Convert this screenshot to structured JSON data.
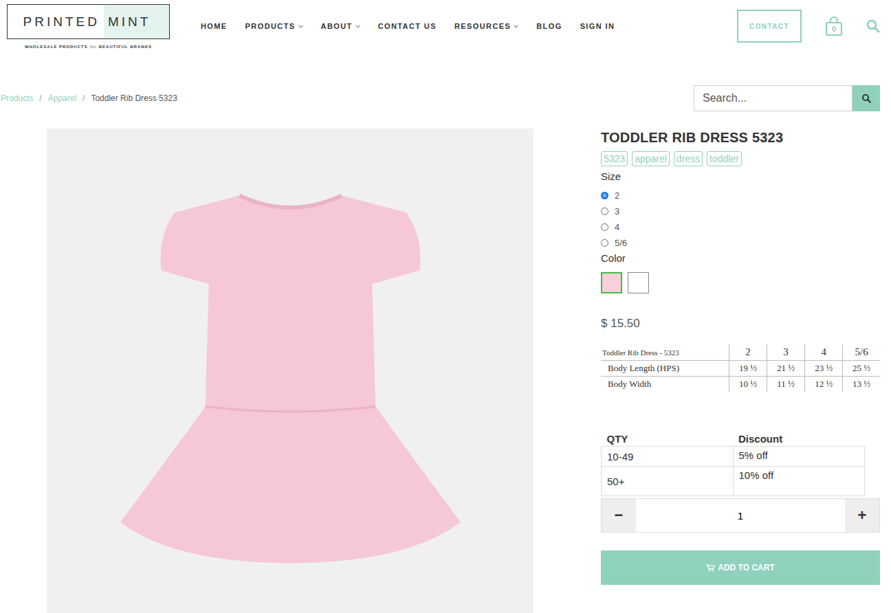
{
  "logo": {
    "left": "PRINTED",
    "right": "MINT",
    "tagline": [
      "WHOLESALE PRODUCTS",
      "for",
      "BEAUTIFUL BRANDS"
    ]
  },
  "nav": [
    {
      "label": "HOME",
      "hasMenu": false
    },
    {
      "label": "PRODUCTS",
      "hasMenu": true
    },
    {
      "label": "ABOUT",
      "hasMenu": true
    },
    {
      "label": "CONTACT US",
      "hasMenu": false
    },
    {
      "label": "RESOURCES",
      "hasMenu": true
    },
    {
      "label": "BLOG",
      "hasMenu": false
    },
    {
      "label": "SIGN IN",
      "hasMenu": false
    }
  ],
  "contactButton": "CONTACT",
  "cartCount": "0",
  "breadcrumb": {
    "separator": "/",
    "items": [
      "Products",
      "Apparel",
      "Toddler Rib Dress 5323"
    ]
  },
  "search": {
    "placeholder": "Search..."
  },
  "product": {
    "title": "TODDLER RIB DRESS 5323",
    "tags": [
      "5323",
      "apparel",
      "dress",
      "toddler"
    ],
    "sizeLabel": "Size",
    "sizes": [
      {
        "label": "2",
        "selected": true
      },
      {
        "label": "3",
        "selected": false
      },
      {
        "label": "4",
        "selected": false
      },
      {
        "label": "5/6",
        "selected": false
      }
    ],
    "colorLabel": "Color",
    "colors": [
      {
        "color": "#f8cfdc",
        "selected": true
      },
      {
        "color": "#ffffff",
        "selected": false
      }
    ],
    "price": "$ 15.50",
    "sizeChart": {
      "title": "Toddler Rib Dress - 5323",
      "columns": [
        "2",
        "3",
        "4",
        "5/6"
      ],
      "rows": [
        {
          "label": "Body Length (HPS)",
          "values": [
            "19 ½",
            "21 ½",
            "23 ½",
            "25 ½"
          ]
        },
        {
          "label": "Body Width",
          "values": [
            "10 ½",
            "11 ½",
            "12 ½",
            "13 ½"
          ]
        }
      ]
    },
    "discounts": {
      "columns": [
        "QTY",
        "Discount"
      ],
      "rows": [
        [
          "10-49",
          "5% off"
        ],
        [
          "50+",
          "10% off"
        ]
      ]
    },
    "quantity": {
      "minus": "−",
      "value": "1",
      "plus": "+"
    },
    "addToCart": "ADD TO CART"
  }
}
